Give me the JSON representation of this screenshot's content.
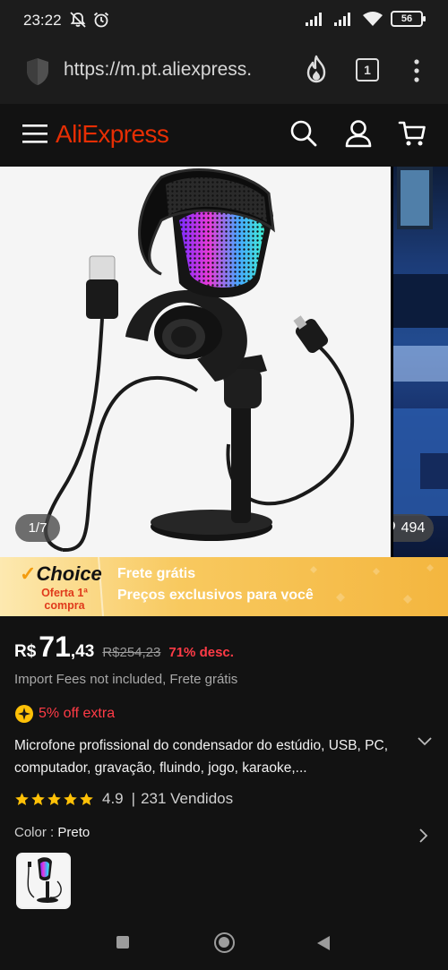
{
  "status_bar": {
    "time": "23:22",
    "battery": "56",
    "icons": [
      "mute-icon",
      "alarm-icon",
      "signal-icon",
      "signal-icon",
      "wifi-icon",
      "battery-icon"
    ]
  },
  "browser": {
    "url": "https://m.pt.aliexpress.",
    "tabs_count": "1"
  },
  "header": {
    "logo": "AliExpress"
  },
  "gallery": {
    "counter": "1/7",
    "likes": "494"
  },
  "choice_banner": {
    "logo": "Choice",
    "sub": "Oferta 1ª compra",
    "line1": "Frete grátis",
    "line2": "Preços exclusivos para você"
  },
  "product": {
    "currency": "R$",
    "price_int": "71",
    "price_dec": ",43",
    "old_price": "R$254,23",
    "discount": "71% desc.",
    "fees": "Import Fees not included, Frete grátis",
    "extra": "5% off extra",
    "title": "Microfone profissional do condensador do estúdio, USB, PC, computador, gravação, fluindo, jogo, karaoke,...",
    "rating": "4.9",
    "separator": "|",
    "sold": "231 Vendidos",
    "stars": 5,
    "color_label": "Color : ",
    "color_value": "Preto"
  },
  "colors": {
    "brand": "#e62e04",
    "discount": "#ff3b46",
    "star": "#ffc107"
  }
}
